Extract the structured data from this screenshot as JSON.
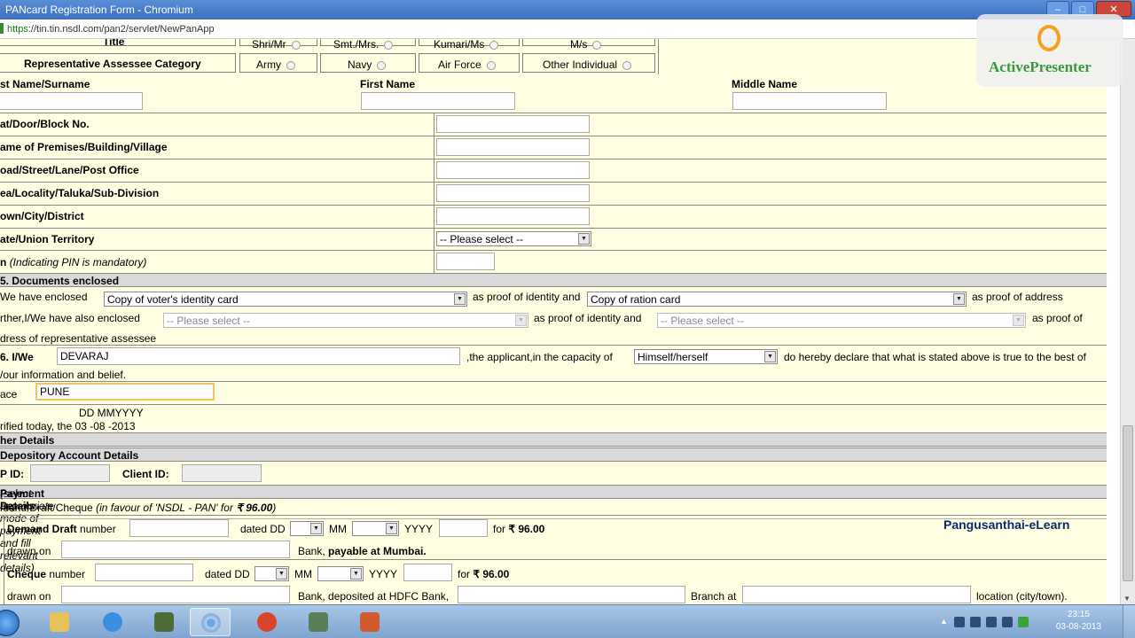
{
  "window": {
    "title": "PANcard Registration Form - Chromium",
    "minimize": "–",
    "maximize": "□",
    "close": "✕"
  },
  "address": {
    "scheme": "https",
    "rest": "://tin.tin.nsdl.com/pan2/servlet/NewPanApp"
  },
  "overlay": {
    "activepresenter": "ActivePresenter",
    "watermark": "Pangusanthai-eLearn"
  },
  "title_row": {
    "label": "Title",
    "options": [
      "Shri/Mr",
      "Smt./Mrs.",
      "Kumari/Ms",
      "M/s"
    ]
  },
  "rep_category": {
    "label": "Representative Assessee Category",
    "options": [
      "Army",
      "Navy",
      "Air Force",
      "Other Individual"
    ]
  },
  "names": {
    "last": "st Name/Surname",
    "first": "First Name",
    "middle": "Middle Name"
  },
  "address_fields": [
    "at/Door/Block No.",
    "ame of Premises/Building/Village",
    "oad/Street/Lane/Post Office",
    "ea/Locality/Taluka/Sub-Division",
    "own/City/District",
    "ate/Union Territory"
  ],
  "state_select": "-- Please select --",
  "pin_label": {
    "prefix": "n",
    "note": "(Indicating PIN is mandatory)"
  },
  "docs": {
    "section": "5. Documents enclosed",
    "line1_prefix": "We have enclosed",
    "proof_identity": "Copy of voter's identity card",
    "as_proof_identity": "as proof of identity and",
    "proof_address": "Copy of ration card",
    "as_proof_address": "as proof of address",
    "line2_prefix": "rther,I/We have also enclosed",
    "rep_identity": "-- Please select --",
    "as_proof_identity2": "as proof of identity and",
    "rep_address": "-- Please select --",
    "as_proof_of": "as proof of",
    "line3": "dress of representative assessee"
  },
  "declaration": {
    "prefix": "6. I/We",
    "name": "DEVARAJ",
    "capacity_text": ",the applicant,in the capacity of",
    "capacity": "Himself/herself",
    "declare_text": "do hereby declare that what is stated above is true to the best of",
    "line2": "/our information and belief."
  },
  "place": {
    "label": "ace",
    "value": "PUNE"
  },
  "verified": {
    "format": "DD MMYYYY",
    "text": "rified today, the",
    "date": "03 -08 -2013"
  },
  "other_details": "her Details",
  "depository": {
    "section": "Depository Account Details",
    "dp_label": "P ID:",
    "client_label": "Client ID:"
  },
  "payment": {
    "section": "Payment Details",
    "section_note": "(select appropriate mode of payment and fill relevant details)",
    "dd_header": "mand Draft/Cheque",
    "dd_note_pre": "(in favour of 'NSDL - PAN' for ",
    "dd_note_amt": "₹ 96.00",
    "dd_note_post": ")",
    "dd": {
      "label": "Demand Draft",
      "number": "number",
      "dated": "dated DD",
      "mm": "MM",
      "yyyy": "YYYY",
      "for": "for",
      "amount": "₹ 96.00",
      "drawn_on": "drawn on",
      "bank": "Bank,",
      "payable": "payable at Mumbai."
    },
    "cheque": {
      "label": "Cheque",
      "number": "number",
      "dated": "dated DD",
      "mm": "MM",
      "yyyy": "YYYY",
      "for": "for",
      "amount": "₹ 96.00",
      "drawn_on": "drawn on",
      "bank_text": "Bank, deposited at HDFC Bank,",
      "branch": "Branch at",
      "location": "location (city/town)."
    }
  },
  "taskbar": {
    "time": "23:15",
    "date": "03-08-2013"
  }
}
